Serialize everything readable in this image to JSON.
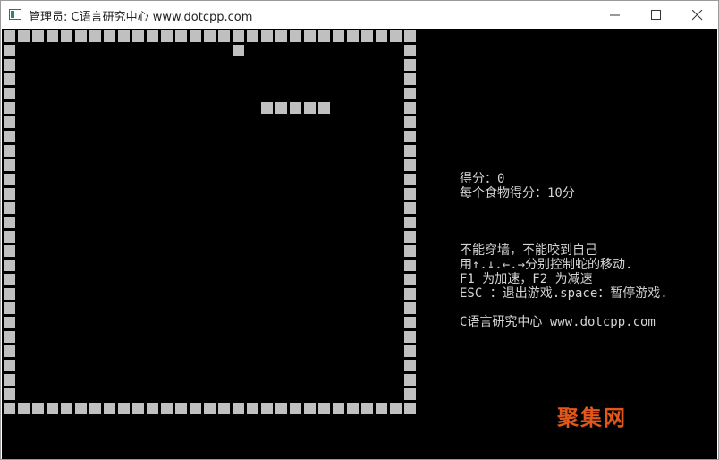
{
  "window": {
    "title": "管理员:  C语言研究中心    www.dotcpp.com"
  },
  "game": {
    "colors": {
      "background": "#000000",
      "block": "#c0c0c0",
      "text": "#d4d4d4"
    },
    "snake_length": 5,
    "food_count": 1
  },
  "info": {
    "score_line": "得分：0",
    "food_score_line": "每个食物得分：10分",
    "rule_wall": "不能穿墙，不能咬到自己",
    "rule_arrows": "用↑.↓.←.→分别控制蛇的移动.",
    "rule_speed": "F1 为加速，F2 为减速",
    "rule_esc": "ESC ：退出游戏.space：暂停游戏.",
    "credit": "C语言研究中心 www.dotcpp.com"
  },
  "watermark": {
    "text": "聚集网",
    "color": "#e4571b"
  }
}
